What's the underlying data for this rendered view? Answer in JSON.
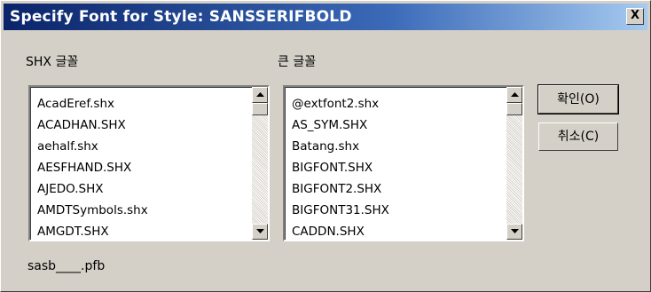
{
  "window": {
    "title": "Specify Font for Style: SANSSERIFBOLD",
    "close_label": "X"
  },
  "shx_font": {
    "label": "SHX 글꼴",
    "items": [
      "AcadEref.shx",
      "ACADHAN.SHX",
      "aehalf.shx",
      "AESFHAND.SHX",
      "AJEDO.SHX",
      "AMDTSymbols.shx",
      "AMGDT.SHX"
    ]
  },
  "big_font": {
    "label": "큰 글꼴",
    "items": [
      "@extfont2.shx",
      "AS_SYM.SHX",
      "Batang.shx",
      "BIGFONT.SHX",
      "BIGFONT2.SHX",
      "BIGFONT31.SHX",
      "CADDN.SHX"
    ]
  },
  "buttons": {
    "ok_label": "확인(O)",
    "cancel_label": "취소(C)"
  },
  "footer": {
    "file_text": "sasb____.pfb"
  },
  "icons": {
    "scroll_up": "up-arrow-icon",
    "scroll_down": "down-arrow-icon",
    "close": "close-icon"
  },
  "colors": {
    "title_start": "#0a246a",
    "title_end": "#a6caf0",
    "face": "#d4d0c8"
  }
}
